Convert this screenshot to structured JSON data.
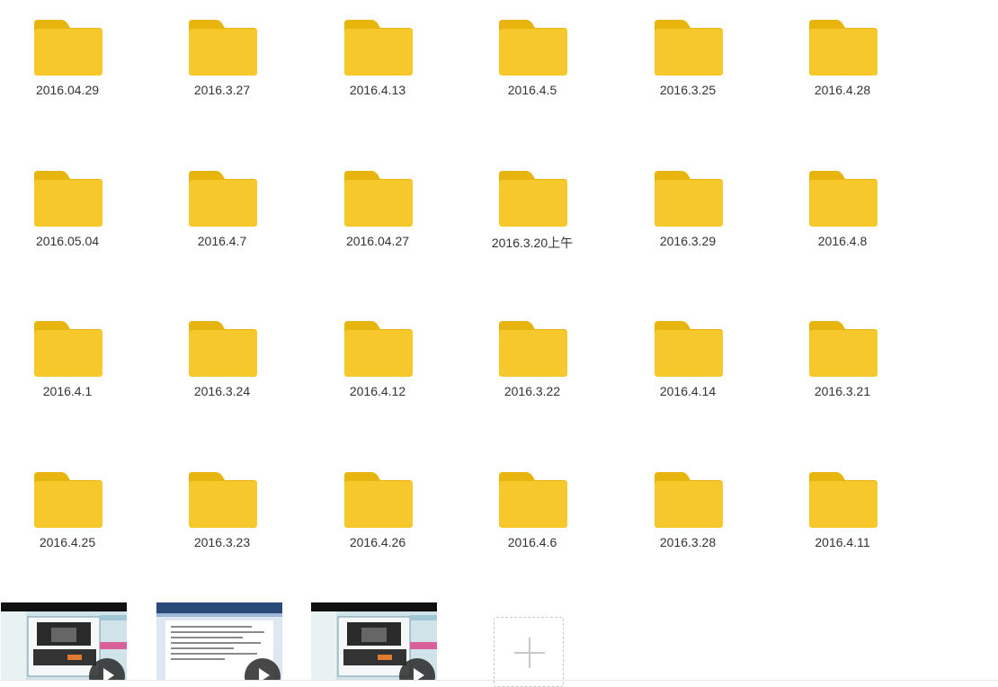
{
  "folder_color": "#F7C82B",
  "folder_tab_color": "#E8B40E",
  "folders": [
    {
      "label": "2016.04.29"
    },
    {
      "label": "2016.3.27"
    },
    {
      "label": "2016.4.13"
    },
    {
      "label": "2016.4.5"
    },
    {
      "label": "2016.3.25"
    },
    {
      "label": "2016.4.28"
    },
    {
      "label": "2016.05.04"
    },
    {
      "label": "2016.4.7"
    },
    {
      "label": "2016.04.27"
    },
    {
      "label": "2016.3.20上午"
    },
    {
      "label": "2016.3.29"
    },
    {
      "label": "2016.4.8"
    },
    {
      "label": "2016.4.1"
    },
    {
      "label": "2016.3.24"
    },
    {
      "label": "2016.4.12"
    },
    {
      "label": "2016.3.22"
    },
    {
      "label": "2016.4.14"
    },
    {
      "label": "2016.3.21"
    },
    {
      "label": "2016.4.25"
    },
    {
      "label": "2016.3.23"
    },
    {
      "label": "2016.4.26"
    },
    {
      "label": "2016.4.6"
    },
    {
      "label": "2016.3.28"
    },
    {
      "label": "2016.4.11"
    }
  ],
  "videos": [
    {
      "icon": "play-icon",
      "variant": "desktop"
    },
    {
      "icon": "play-icon",
      "variant": "document"
    },
    {
      "icon": "play-icon",
      "variant": "desktop"
    }
  ],
  "add_tile": {
    "icon": "plus-icon"
  }
}
